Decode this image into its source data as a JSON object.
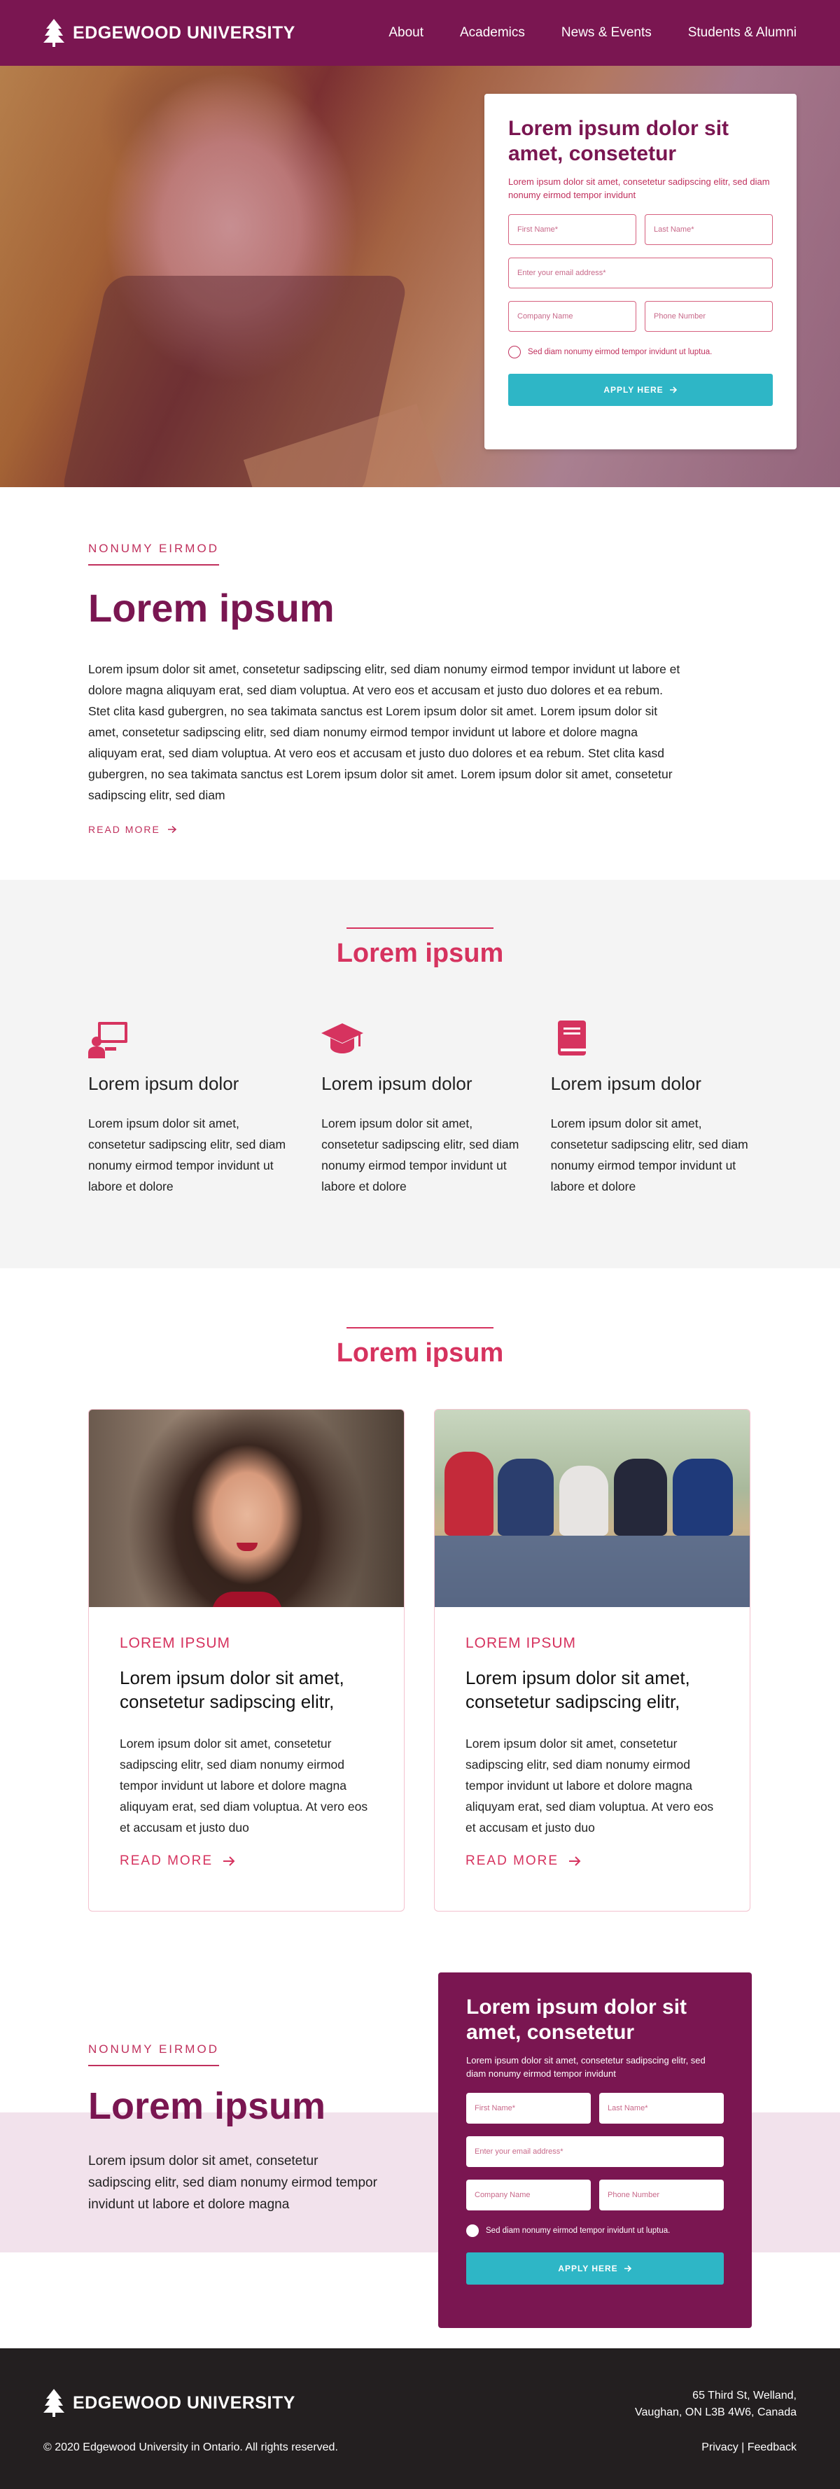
{
  "header": {
    "brand": "EDGEWOOD UNIVERSITY",
    "nav": [
      "About",
      "Academics",
      "News & Events",
      "Students & Alumni"
    ]
  },
  "hero_form": {
    "title": "Lorem ipsum dolor sit amet, consetetur",
    "subtitle": "Lorem ipsum dolor sit amet, consetetur sadipscing elitr, sed diam nonumy eirmod tempor invidunt",
    "first_name": "First Name*",
    "last_name": "Last Name*",
    "email": "Enter your email address*",
    "company": "Company Name",
    "phone": "Phone Number",
    "checkbox_label": "Sed diam nonumy eirmod tempor invidunt ut luptua.",
    "button": "APPLY HERE"
  },
  "intro": {
    "eyebrow": "NONUMY EIRMOD",
    "title": "Lorem ipsum",
    "body": "Lorem ipsum dolor sit amet, consetetur sadipscing elitr, sed diam nonumy eirmod tempor invidunt ut labore et dolore magna aliquyam erat, sed diam voluptua. At vero eos et accusam et justo duo dolores et ea rebum. Stet clita kasd gubergren, no sea takimata sanctus est Lorem ipsum dolor sit amet. Lorem ipsum dolor sit amet, consetetur sadipscing elitr, sed diam nonumy eirmod tempor invidunt ut labore et dolore magna aliquyam erat, sed diam voluptua. At vero eos et accusam et justo duo dolores et ea rebum. Stet clita kasd gubergren, no sea takimata sanctus est Lorem ipsum dolor sit amet. Lorem ipsum dolor sit amet, consetetur sadipscing elitr, sed diam",
    "read_more": "READ MORE"
  },
  "features": {
    "title": "Lorem ipsum",
    "items": [
      {
        "icon": "teacher-board-icon",
        "title": "Lorem ipsum dolor",
        "body": "Lorem ipsum dolor sit amet, consetetur sadipscing elitr, sed diam nonumy eirmod tempor invidunt ut labore et dolore"
      },
      {
        "icon": "graduation-cap-icon",
        "title": "Lorem ipsum dolor",
        "body": "Lorem ipsum dolor sit amet, consetetur sadipscing elitr, sed diam nonumy eirmod tempor invidunt ut labore et dolore"
      },
      {
        "icon": "book-icon",
        "title": "Lorem ipsum dolor",
        "body": "Lorem ipsum dolor sit amet, consetetur sadipscing elitr, sed diam nonumy eirmod tempor invidunt ut labore et dolore"
      }
    ]
  },
  "cards_section": {
    "title": "Lorem ipsum",
    "cards": [
      {
        "eyebrow": "LOREM IPSUM",
        "title": "Lorem ipsum dolor sit amet, consetetur sadipscing elitr,",
        "body": "Lorem ipsum dolor sit amet, consetetur sadipscing elitr, sed diam nonumy eirmod tempor invidunt ut labore et dolore magna aliquyam erat, sed diam voluptua. At vero eos et accusam et justo duo",
        "more": "READ MORE"
      },
      {
        "eyebrow": "LOREM IPSUM",
        "title": "Lorem ipsum dolor sit amet, consetetur sadipscing elitr,",
        "body": "Lorem ipsum dolor sit amet, consetetur sadipscing elitr, sed diam nonumy eirmod tempor invidunt ut labore et dolore magna aliquyam erat, sed diam voluptua. At vero eos et accusam et justo duo",
        "more": "READ MORE"
      }
    ]
  },
  "cta": {
    "eyebrow": "NONUMY EIRMOD",
    "title": "Lorem ipsum",
    "body": "Lorem ipsum dolor sit amet, consetetur sadipscing elitr, sed diam nonumy eirmod tempor invidunt ut labore et dolore magna",
    "form": {
      "title": "Lorem ipsum dolor sit amet, consetetur",
      "subtitle": "Lorem ipsum dolor sit amet, consetetur sadipscing elitr, sed diam nonumy eirmod tempor invidunt",
      "first_name": "First Name*",
      "last_name": "Last Name*",
      "email": "Enter your email address*",
      "company": "Company Name",
      "phone": "Phone Number",
      "checkbox_label": "Sed diam nonumy eirmod tempor invidunt ut luptua.",
      "button": "APPLY HERE"
    }
  },
  "footer": {
    "brand": "EDGEWOOD UNIVERSITY",
    "address_line1": "65 Third St, Welland,",
    "address_line2": "Vaughan, ON L3B 4W6, Canada",
    "copyright": "© 2020 Edgewood University in Ontario. All rights reserved.",
    "links": "Privacy | Feedback"
  },
  "colors": {
    "brand": "#7a1651",
    "accent": "#d6335f",
    "button": "#2eb6c6",
    "footer": "#231f20"
  }
}
